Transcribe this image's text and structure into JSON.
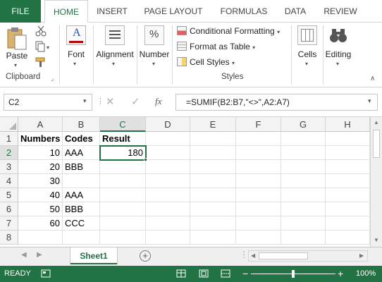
{
  "ribbon_tabs": [
    "FILE",
    "HOME",
    "INSERT",
    "PAGE LAYOUT",
    "FORMULAS",
    "DATA",
    "REVIEW"
  ],
  "clipboard": {
    "paste_label": "Paste",
    "group_label": "Clipboard"
  },
  "font": {
    "label": "Font",
    "icon_letter": "A"
  },
  "alignment": {
    "label": "Alignment"
  },
  "number": {
    "label": "Number",
    "icon_symbol": "%"
  },
  "styles": {
    "conditional_formatting": "Conditional Formatting",
    "format_as_table": "Format as Table",
    "cell_styles": "Cell Styles",
    "group_label": "Styles"
  },
  "cells": {
    "label": "Cells"
  },
  "editing": {
    "label": "Editing"
  },
  "formula_bar": {
    "name_box": "C2",
    "fx_label": "fx",
    "formula": "=SUMIF(B2:B7,\"<>\",A2:A7)"
  },
  "grid": {
    "columns": [
      "A",
      "B",
      "C",
      "D",
      "E",
      "F",
      "G",
      "H"
    ],
    "rows": [
      "1",
      "2",
      "3",
      "4",
      "5",
      "6",
      "7",
      "8"
    ],
    "selected_column": "C",
    "selected_row": "2",
    "cells": {
      "A1": "Numbers",
      "B1": "Codes",
      "C1": "Result",
      "A2": "10",
      "B2": "AAA",
      "C2": "180",
      "A3": "20",
      "B3": "BBB",
      "A4": "30",
      "A5": "40",
      "B5": "AAA",
      "A6": "50",
      "B6": "BBB",
      "A7": "60",
      "B7": "CCC"
    }
  },
  "sheet_tabs": {
    "active": "Sheet1",
    "add_symbol": "+"
  },
  "status_bar": {
    "ready": "READY",
    "zoom": "100%",
    "zoom_minus": "−",
    "zoom_plus": "+"
  },
  "colors": {
    "accent": "#217346",
    "header_bg": "#f3f3f3",
    "grid_line": "#e1e1e1"
  }
}
